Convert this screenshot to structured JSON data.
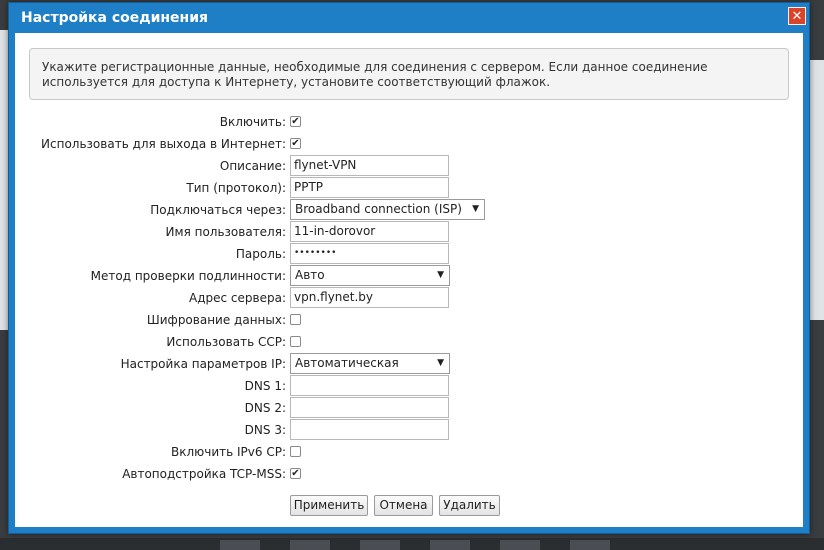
{
  "dialog": {
    "title": "Настройка соединения",
    "close_symbol": "✕",
    "notice": "Укажите регистрационные данные, необходимые для соединения с сервером. Если данное соединение используется для доступа к Интернету, установите соответствующий флажок."
  },
  "form": {
    "enable": {
      "label": "Включить:",
      "checked": true
    },
    "use_internet": {
      "label": "Использовать для выхода в Интернет:",
      "checked": true
    },
    "description": {
      "label": "Описание:",
      "value": "flynet-VPN"
    },
    "type": {
      "label": "Тип (протокол):",
      "value": "PPTP"
    },
    "connect_via": {
      "label": "Подключаться через:",
      "value": "Broadband connection (ISP)"
    },
    "username": {
      "label": "Имя пользователя:",
      "value": "11-in-dorovor"
    },
    "password": {
      "label": "Пароль:",
      "value": "••••••••"
    },
    "auth_method": {
      "label": "Метод проверки подлинности:",
      "value": "Авто"
    },
    "server": {
      "label": "Адрес сервера:",
      "value": "vpn.flynet.by"
    },
    "encryption": {
      "label": "Шифрование данных:",
      "checked": false
    },
    "ccp": {
      "label": "Использовать CCP:",
      "checked": false
    },
    "ip_settings": {
      "label": "Настройка параметров IP:",
      "value": "Автоматическая"
    },
    "dns1": {
      "label": "DNS 1:",
      "value": ""
    },
    "dns2": {
      "label": "DNS 2:",
      "value": ""
    },
    "dns3": {
      "label": "DNS 3:",
      "value": ""
    },
    "ipv6cp": {
      "label": "Включить IPv6 CP:",
      "checked": false
    },
    "tcp_mss": {
      "label": "Автоподстройка TCP-MSS:",
      "checked": true
    }
  },
  "buttons": {
    "apply": "Применить",
    "cancel": "Отмена",
    "delete": "Удалить"
  },
  "check_mark": "✔",
  "dropdown_arrow": "▼"
}
